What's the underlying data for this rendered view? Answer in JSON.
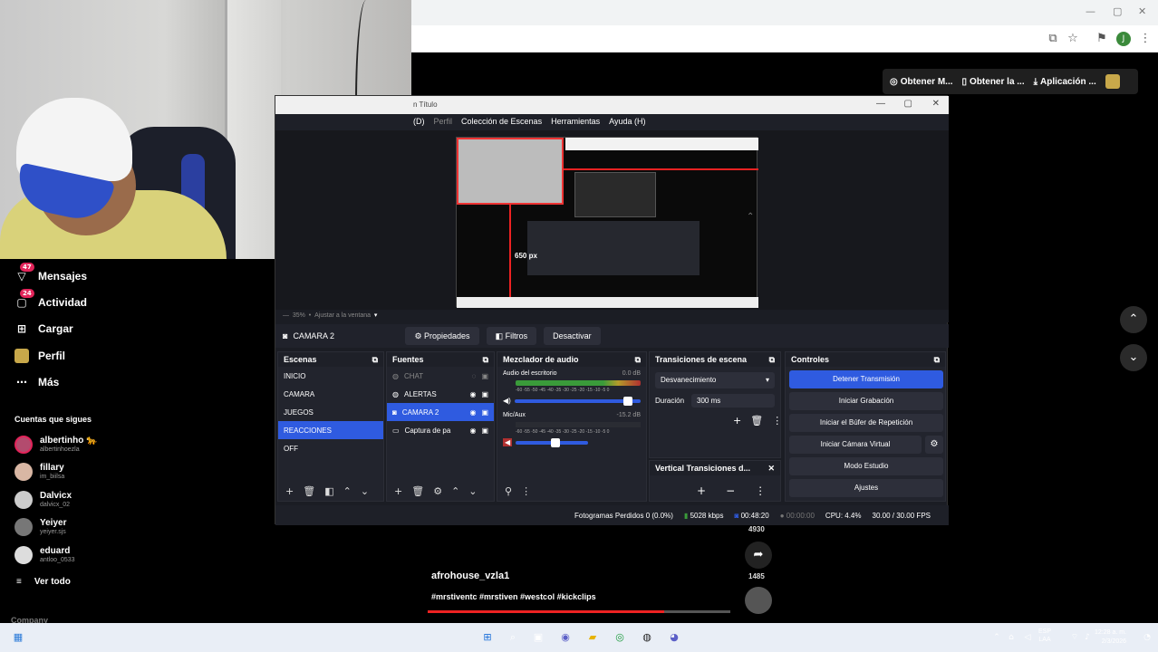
{
  "chrome": {
    "window_controls": [
      "—",
      "▢",
      "✕"
    ],
    "profile_letter": "J"
  },
  "kick_toolbar": [
    {
      "icon": "circle-icon",
      "label": "Obtener M..."
    },
    {
      "icon": "phone-icon",
      "label": "Obtener la ..."
    },
    {
      "icon": "download-icon",
      "label": "Aplicación ..."
    }
  ],
  "nav": [
    {
      "id": "messages",
      "label": "Mensajes",
      "badge": "47",
      "icon": "message-icon"
    },
    {
      "id": "activity",
      "label": "Actividad",
      "badge": "24",
      "icon": "activity-icon"
    },
    {
      "id": "upload",
      "label": "Cargar",
      "badge": "",
      "icon": "upload-icon"
    },
    {
      "id": "profile",
      "label": "Perfil",
      "badge": "",
      "icon": "profile-icon"
    },
    {
      "id": "more",
      "label": "Más",
      "badge": "",
      "icon": "more-icon"
    }
  ],
  "following": {
    "heading": "Cuentas que sigues",
    "accounts": [
      {
        "name": "albertinho 🐆",
        "handle": "albertinhoezla"
      },
      {
        "name": "fillary",
        "handle": "im_biilsa"
      },
      {
        "name": "Dalvicx",
        "handle": "dalvicx_02"
      },
      {
        "name": "Yeiyer",
        "handle": "yeiyer.sjs"
      },
      {
        "name": "eduard",
        "handle": "antloo_0533"
      }
    ],
    "see_all": "Ver todo",
    "company": "Company"
  },
  "obs": {
    "title": "n Título",
    "menu": [
      "(D)",
      "Perfil",
      "Colección de Escenas",
      "Herramientas",
      "Ayuda (H)"
    ],
    "preview_label": "650 px",
    "zoom_text": "35%",
    "fit_text": "Ajustar a la ventana",
    "source_name": "CAMARA 2",
    "source_buttons": [
      "Propiedades",
      "Filtros",
      "Desactivar"
    ],
    "scenes": {
      "title": "Escenas",
      "items": [
        "INICIO",
        "CAMARA",
        "JUEGOS",
        "REACCIONES",
        "OFF"
      ],
      "selected": 3
    },
    "sources": {
      "title": "Fuentes",
      "items": [
        "CHAT",
        "ALERTAS",
        "CAMARA 2",
        "Captura de pa"
      ],
      "selected": 2
    },
    "audio": {
      "title": "Mezclador de audio",
      "channels": [
        {
          "name": "Audio del escritorio",
          "db": "0.0 dB",
          "level": 0.9
        },
        {
          "name": "Mic/Aux",
          "db": "-15.2 dB",
          "level": 0.55
        }
      ]
    },
    "transitions": {
      "title": "Transiciones de escena",
      "selected": "Desvanecimiento",
      "duration_label": "Duración",
      "duration_value": "300 ms",
      "vertical_title": "Vertical Transiciones d..."
    },
    "controls": {
      "title": "Controles",
      "buttons": [
        "Detener Transmisión",
        "Iniciar Grabación",
        "Iniciar el Búfer de Repetición",
        "Iniciar Cámara Virtual",
        "Modo Estudio",
        "Ajustes"
      ]
    },
    "status": {
      "dropped": "Fotogramas Perdidos 0 (0.0%)",
      "kbps": "5028 kbps",
      "time": "00:48:20",
      "rec_time": "00:00:00",
      "cpu": "CPU: 4.4%",
      "fps": "30.00 / 30.00 FPS"
    }
  },
  "stream": {
    "user": "afrohouse_vzla1",
    "tags": "#mrstiventc #mrstiven #westcol #kickclips",
    "share_count_top": "4930",
    "share_count": "1485",
    "progress": 0.78
  },
  "taskbar": {
    "lang": "ESP",
    "lang_sub": "LAA",
    "time": "12:28 a. m.",
    "date": "2/3/2026"
  },
  "colors": {
    "accent": "#2f5be0",
    "kick_red": "#e22",
    "obs_bg": "#22242d"
  }
}
